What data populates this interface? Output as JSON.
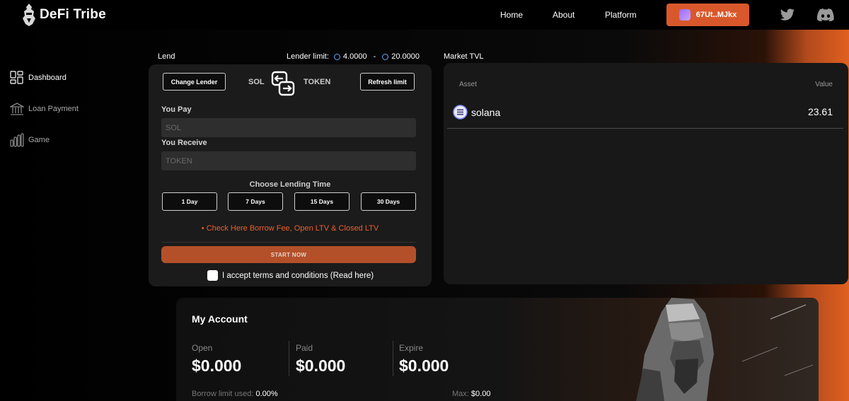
{
  "brand": {
    "name": "DeFi Tribe"
  },
  "nav": {
    "home": "Home",
    "about": "About",
    "platform": "Platform"
  },
  "wallet": {
    "address": "67Ut..MJkx"
  },
  "sidebar": {
    "items": [
      {
        "label": "Dashboard",
        "icon": "dashboard-icon",
        "active": true
      },
      {
        "label": "Loan Payment",
        "icon": "bank-icon",
        "active": false
      },
      {
        "label": "Game",
        "icon": "bar-chart-icon",
        "active": false
      }
    ]
  },
  "lend": {
    "title": "Lend",
    "lender_limit_label": "Lender limit:",
    "limit_min": "4.0000",
    "limit_sep": "-",
    "limit_max": "20.0000",
    "change_lender": "Change Lender",
    "from_token": "SOL",
    "to_token": "TOKEN",
    "refresh_limit": "Refresh limit",
    "you_pay_label": "You Pay",
    "you_pay_placeholder": "SOL",
    "you_receive_label": "You Receive",
    "you_receive_placeholder": "TOKEN",
    "choose_time_label": "Choose Lending Time",
    "time_options": [
      "1 Day",
      "7 Days",
      "15 Days",
      "30 Days"
    ],
    "fee_link": "• Check Here Borrow Fee, Open LTV & Closed LTV",
    "start_button": "START NOW",
    "terms_label": "I accept terms and conditions (Read here)"
  },
  "tvl": {
    "title": "Market TVL",
    "col_asset": "Asset",
    "col_value": "Value",
    "rows": [
      {
        "asset": "solana",
        "value": "23.61"
      }
    ]
  },
  "account": {
    "title": "My Account",
    "open_label": "Open",
    "open_value": "$0.000",
    "paid_label": "Paid",
    "paid_value": "$0.000",
    "expire_label": "Expire",
    "expire_value": "$0.000",
    "borrow_limit_label": "Borrow limit used:",
    "borrow_limit_value": "0.00%",
    "max_label": "Max:",
    "max_value": "$0.00"
  },
  "colors": {
    "accent": "#d9582b",
    "panel": "#1b1b1b",
    "link": "#e8602c"
  }
}
